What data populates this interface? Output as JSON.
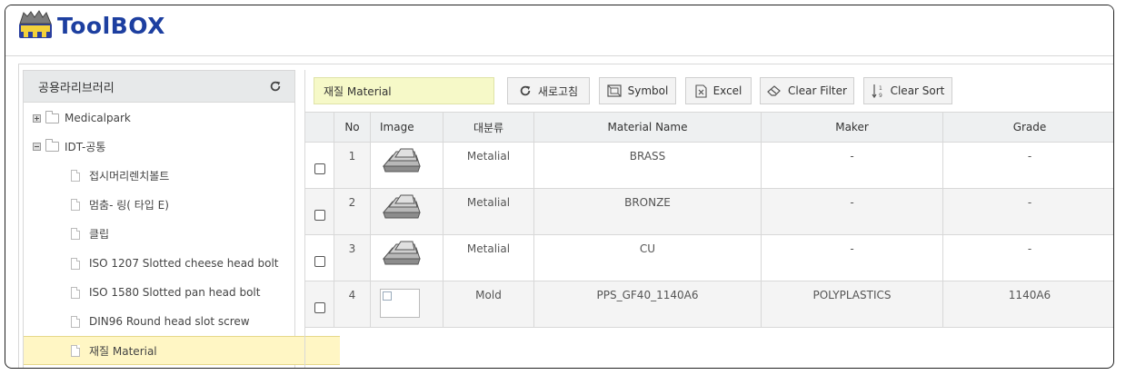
{
  "app": {
    "logo_text": "ToolBOX"
  },
  "sidebar": {
    "title": "공용라리브러리",
    "refresh_icon": "refresh-icon",
    "items": [
      {
        "label": "Medicalpark",
        "type": "folder",
        "state": "collapsed"
      },
      {
        "label": "IDT-공통",
        "type": "folder",
        "state": "expanded"
      },
      {
        "label": "접시머리렌치볼트",
        "type": "file"
      },
      {
        "label": "멈춤- 링( 타입 E)",
        "type": "file"
      },
      {
        "label": "클립",
        "type": "file"
      },
      {
        "label": "ISO 1207 Slotted cheese head bolt",
        "type": "file"
      },
      {
        "label": "ISO 1580 Slotted pan head bolt",
        "type": "file"
      },
      {
        "label": "DIN96 Round head slot screw",
        "type": "file"
      },
      {
        "label": "재질 Material",
        "type": "file",
        "selected": true
      }
    ]
  },
  "toolbar": {
    "title": "재질 Material",
    "buttons": [
      {
        "label": "새로고침",
        "icon": "refresh-icon"
      },
      {
        "label": "Symbol",
        "icon": "symbol-icon"
      },
      {
        "label": "Excel",
        "icon": "excel-icon"
      },
      {
        "label": "Clear Filter",
        "icon": "eraser-icon"
      },
      {
        "label": "Clear Sort",
        "icon": "sort-icon"
      }
    ]
  },
  "grid": {
    "columns": [
      "",
      "No",
      "Image",
      "대분류",
      "Material Name",
      "Maker",
      "Grade"
    ],
    "rows": [
      {
        "no": "1",
        "image": "metal-ingot-image",
        "category": "Metalial",
        "name": "BRASS",
        "maker": "-",
        "grade": "-"
      },
      {
        "no": "2",
        "image": "metal-ingot-image",
        "category": "Metalial",
        "name": "BRONZE",
        "maker": "-",
        "grade": "-"
      },
      {
        "no": "3",
        "image": "metal-ingot-image",
        "category": "Metalial",
        "name": "CU",
        "maker": "-",
        "grade": "-"
      },
      {
        "no": "4",
        "image": "broken-image",
        "category": "Mold",
        "name": "PPS_GF40_1140A6",
        "maker": "POLYPLASTICS",
        "grade": "1140A6"
      }
    ]
  },
  "colors": {
    "logo": "#1d3fa0",
    "selected_row": "#fff6c4",
    "title_box": "#f6f9c8",
    "header_bg": "#eef0f1"
  }
}
